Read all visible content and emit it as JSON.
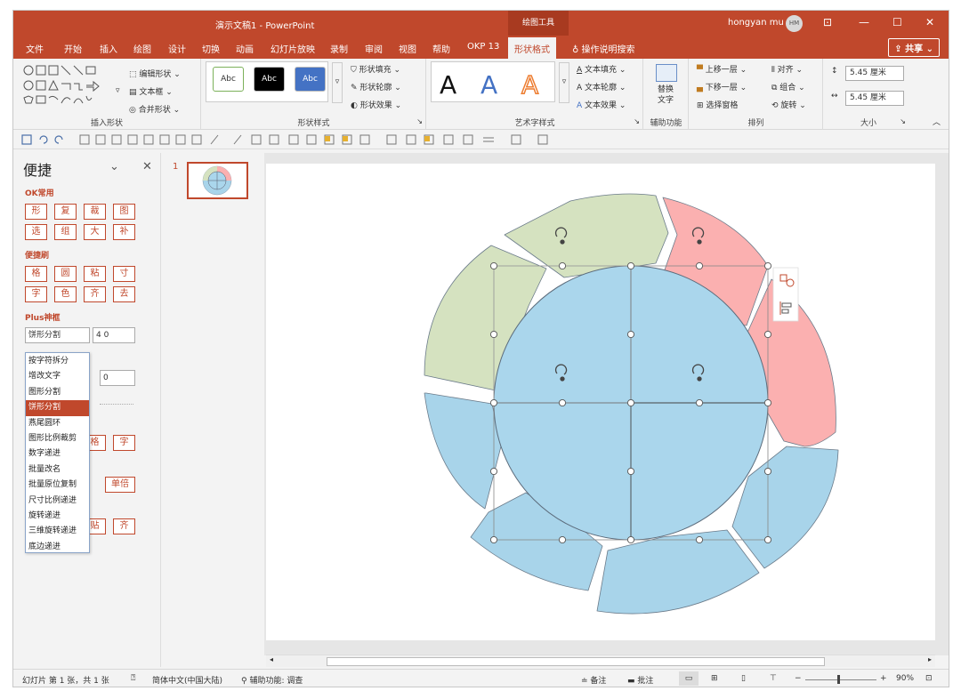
{
  "window": {
    "title": "演示文稿1 - PowerPoint",
    "context_tab": "绘图工具",
    "user_name": "hongyan mu",
    "user_initials": "HM"
  },
  "tabs": [
    "文件",
    "开始",
    "插入",
    "绘图",
    "设计",
    "切换",
    "动画",
    "幻灯片放映",
    "录制",
    "审阅",
    "视图",
    "帮助",
    "OKP 13",
    "形状格式"
  ],
  "help_search": "操作说明搜索",
  "share_label": "共享",
  "ribbon": {
    "insert_shapes": {
      "label": "插入形状",
      "edit_shape": "编辑形状",
      "textbox": "文本框",
      "merge_shapes": "合并形状"
    },
    "shape_styles": {
      "label": "形状样式",
      "sample": "Abc",
      "fill": "形状填充",
      "outline": "形状轮廓",
      "effect": "形状效果"
    },
    "wordart": {
      "label": "艺术字样式",
      "sample": "A",
      "text_fill": "文本填充",
      "text_outline": "文本轮廓",
      "text_effect": "文本效果"
    },
    "accessibility": {
      "label": "辅助功能",
      "alt_text": "替换文字",
      "alt_text_line1": "替换",
      "alt_text_line2": "文字"
    },
    "arrange": {
      "label": "排列",
      "bring_forward": "上移一层",
      "send_backward": "下移一层",
      "selection_pane": "选择窗格",
      "align": "对齐",
      "group": "组合",
      "rotate": "旋转"
    },
    "size": {
      "label": "大小",
      "height": "5.45 厘米",
      "width": "5.45 厘米"
    }
  },
  "pane": {
    "title": "便捷",
    "sections": {
      "ok_common": {
        "label": "OK常用",
        "buttons": [
          "形",
          "复",
          "裁",
          "图",
          "选",
          "组",
          "大",
          "补"
        ]
      },
      "format_brush": {
        "label": "便捷刷",
        "buttons": [
          "格",
          "圆",
          "粘",
          "寸",
          "字",
          "色",
          "齐",
          "去"
        ]
      },
      "plus": {
        "label": "Plus神框"
      }
    },
    "combo_value": "饼形分割",
    "number_value": "4 0",
    "field2_value": "0",
    "dropdown": [
      "按字符拆分",
      "增改文字",
      "图形分割",
      "饼形分割",
      "燕尾圆环",
      "图形比例裁剪",
      "数字递进",
      "批量改名",
      "批量原位复制",
      "尺寸比例递进",
      "旋转递进",
      "三维旋转递进",
      "底边递进"
    ],
    "dropdown_selected": 3,
    "extra_buttons": [
      "格",
      "字",
      "单倍",
      "贴",
      "齐"
    ]
  },
  "slides_panel": {
    "slide_number": "1"
  },
  "status": {
    "slide_info": "幻灯片 第 1 张，共 1 张",
    "language": "简体中文(中国大陆)",
    "accessibility": "辅助功能: 调查",
    "notes": "备注",
    "comments": "批注",
    "zoom": "90%"
  },
  "colors": {
    "accent": "#c0482c",
    "segment_green": "#d5e2c0",
    "segment_pink": "#fbb0b0",
    "segment_blue": "#a8d4ea",
    "circle_blue": "#aad6ec"
  }
}
